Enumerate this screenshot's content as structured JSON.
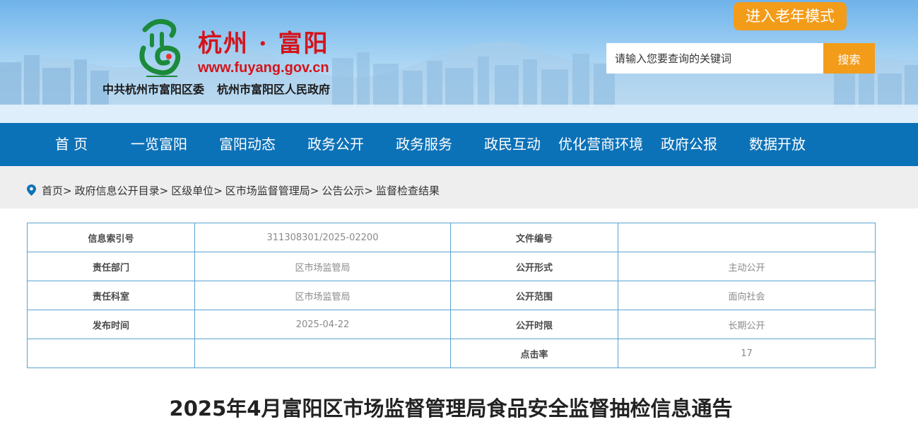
{
  "header": {
    "site_name": "杭州 · 富阳",
    "site_url": "www.fuyang.gov.cn",
    "org_party": "中共杭州市富阳区委",
    "org_gov": "杭州市富阳区人民政府",
    "elder_mode_label": "进入老年模式",
    "search_placeholder": "请输入您要查询的关键词",
    "search_button_label": "搜索"
  },
  "nav": {
    "items": [
      {
        "label": "首 页"
      },
      {
        "label": "一览富阳"
      },
      {
        "label": "富阳动态"
      },
      {
        "label": "政务公开"
      },
      {
        "label": "政务服务"
      },
      {
        "label": "政民互动"
      },
      {
        "label": "优化营商环境"
      },
      {
        "label": "政府公报"
      },
      {
        "label": "数据开放"
      }
    ]
  },
  "breadcrumb": {
    "icon": "location-pin-icon",
    "items": [
      "首页",
      "政府信息公开目录",
      "区级单位",
      "区市场监督管理局",
      "公告公示"
    ],
    "separator": ">",
    "current": "监督检查结果"
  },
  "info": {
    "rows": [
      {
        "label1": "信息索引号",
        "value1": "311308301/2025-02200",
        "label2": "文件编号",
        "value2": ""
      },
      {
        "label1": "责任部门",
        "value1": "区市场监管局",
        "label2": "公开形式",
        "value2": "主动公开"
      },
      {
        "label1": "责任科室",
        "value1": "区市场监管局",
        "label2": "公开范围",
        "value2": "面向社会"
      },
      {
        "label1": "发布时间",
        "value1": "2025-04-22",
        "label2": "公开时限",
        "value2": "长期公开"
      },
      {
        "label1": "",
        "value1": "",
        "label2": "点击率",
        "value2": "17"
      }
    ]
  },
  "article": {
    "title": "2025年4月富阳区市场监督管理局食品安全监督抽检信息通告"
  },
  "colors": {
    "nav_blue": "#0c72b8",
    "brand_red": "#d4141b",
    "accent_orange": "#f39c1a",
    "table_border": "#5aa3cf"
  }
}
